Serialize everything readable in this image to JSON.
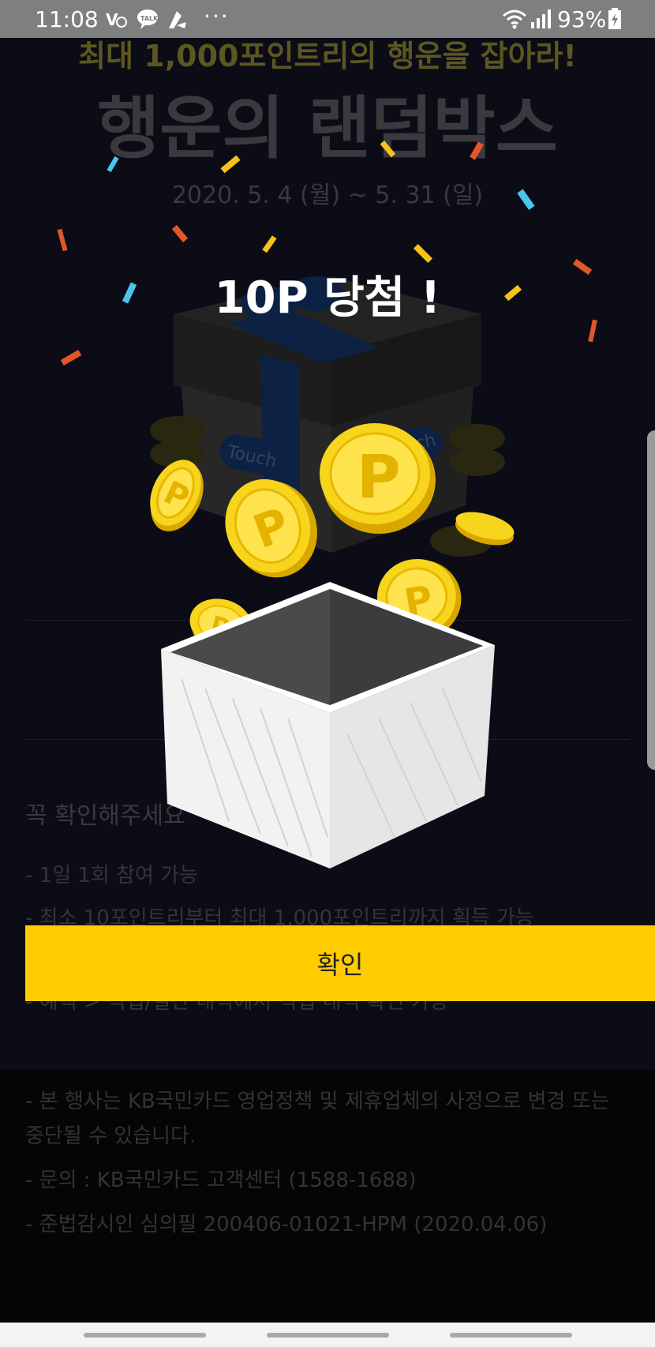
{
  "status_bar": {
    "time": "11:08",
    "icons": [
      "volte-icon",
      "talk-icon",
      "app-icon"
    ],
    "more": "···",
    "battery": "93%"
  },
  "background_page": {
    "subtitle": "최대 1,000포인트리의 행운을 잡아라!",
    "title": "행운의 랜덤박스",
    "date": "2020. 5. 4 (월) ~ 5. 31 (일)",
    "box_touch_labels": [
      "Touch",
      "Touch"
    ],
    "notice_title": "꼭 확인해주세요",
    "notices": [
      "- 1일 1회 참여 가능",
      "- 최소 10포인트리부터 최대 1,000포인트리까지 획득 가능",
      "- 혜택 > 적립/결산 내역에서 적립 내역 확인 가능"
    ],
    "footer": [
      "- 본 행사는 KB국민카드 영업정책 및 제휴업체의 사정으로 변경 또는",
      "  중단될 수 있습니다.",
      "- 문의 : KB국민카드 고객센터 (1588-1688)",
      "- 준법감시인 심의필 200406-01021-HPM (2020.04.06)"
    ]
  },
  "modal": {
    "title": "10P 당첨 !",
    "coin_letter": "P",
    "confirm_label": "확인"
  },
  "colors": {
    "accent": "#ffcc00",
    "coin": "#f7d51d",
    "overlay_bg": "#0b0c16"
  }
}
